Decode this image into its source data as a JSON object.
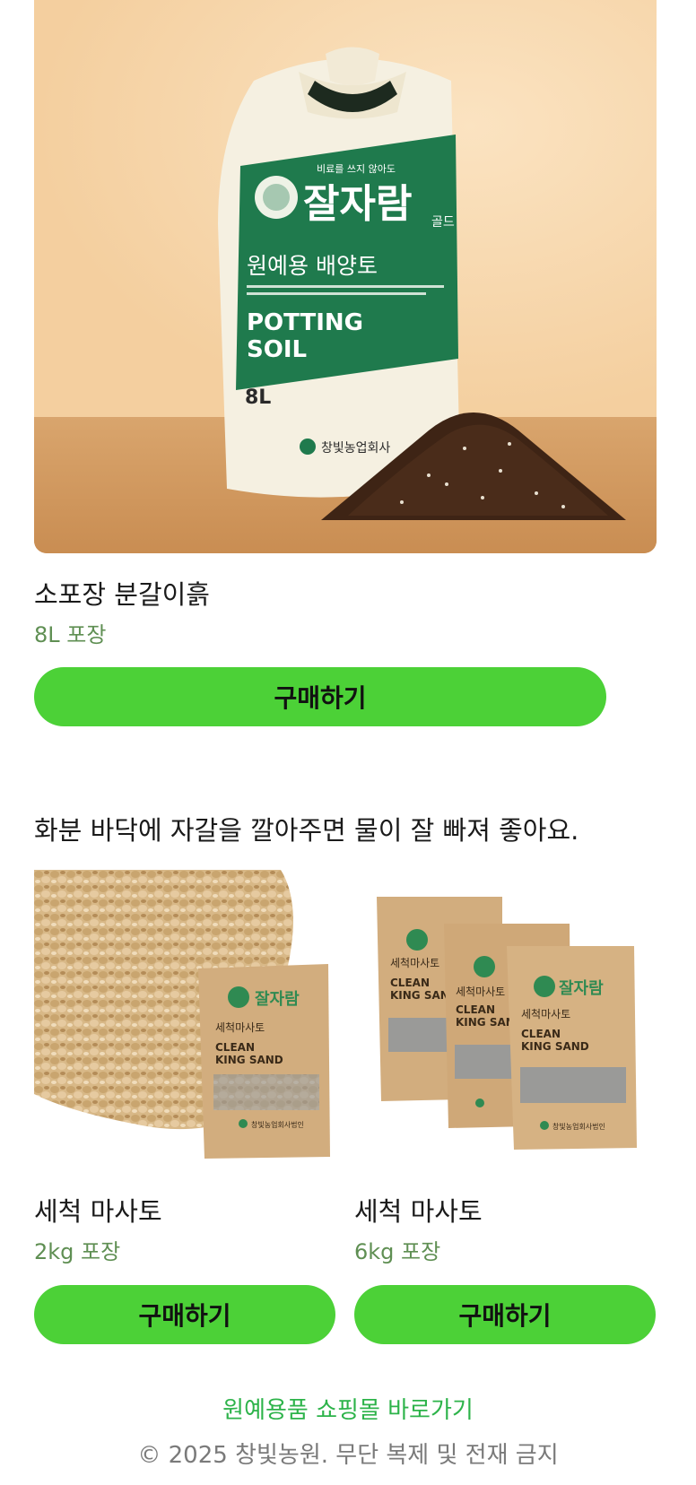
{
  "featured": {
    "bag": {
      "tagline": "비료를 쓰지 않아도",
      "brand": "잘자람",
      "brand_suffix": "골드",
      "kind": "원예용 배양토",
      "english": "POTTING",
      "english2": "SOIL",
      "volume": "8L",
      "maker": "창빛농업회사"
    },
    "title": "소포장 분갈이흙",
    "subtitle": "8L 포장",
    "buy_label": "구매하기"
  },
  "intro_text": "화분 바닥에 자갈을 깔아주면 물이 잘 빠져 좋아요.",
  "products": [
    {
      "title": "세척 마사토",
      "subtitle": "2kg 포장",
      "buy_label": "구매하기",
      "bag": {
        "brand": "잘자람",
        "name": "세척마사토",
        "english": "CLEAN",
        "english2": "KING SAND",
        "maker": "창빛농업회사법인"
      }
    },
    {
      "title": "세척 마사토",
      "subtitle": "6kg 포장",
      "buy_label": "구매하기",
      "bag": {
        "brand": "잘자람",
        "name": "세척마사토",
        "english": "CLEAN",
        "english2": "KING SAND",
        "maker": "창빛농업회사법인"
      }
    }
  ],
  "footer": {
    "shop_link": "원예용품 쇼핑몰 바로가기",
    "copyright": "© 2025 창빛농원. 무단 복제 및 전재 금지"
  },
  "colors": {
    "accent": "#4cd137",
    "subtitle": "#5f8f53",
    "link": "#2db34a",
    "bag_green": "#1f7a4d",
    "kraft": "#d2ad7e"
  }
}
